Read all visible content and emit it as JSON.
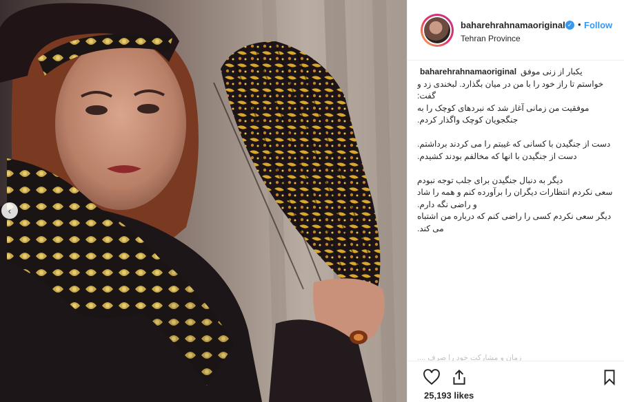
{
  "post": {
    "username": "baharehrahnamaoriginal",
    "follow_label": "Follow",
    "separator": "•",
    "verified_mark": "✓",
    "location": "Tehran Province",
    "caption_lines": [
      "یکبار از زنی موفق",
      "خواستم تا راز خود را با من در میان بگذارد. لبخندی زد و گفت:",
      "موفقیت من زمانی آغاز شد که نبردهای کوچک را به جنگجویان کوچک واگذار کردم.",
      "",
      "دست از جنگیدن با کسانی که غیبتم را می کردند برداشتم.",
      "دست از جنگیدن با انها که مخالفم بودند کشیدم.",
      "",
      "دیگر به دنبال جنگیدن برای جلب توجه نبودم",
      "سعی نکردم انتظارات دیگران را برآورده کنم و همه را شاد و راضی نگه دارم.",
      "دیگر سعی نکردم کسی را راضی کنم که درباره من اشتباه می کند."
    ],
    "faded_line": "زمان و مشارکت خود را صرف ....",
    "likes": "25,193 likes",
    "prev_label": "‹"
  },
  "icons": {
    "like": "heart-icon",
    "share": "share-icon",
    "save": "bookmark-icon",
    "prev": "chevron-left-icon",
    "verified": "verified-badge-icon"
  },
  "colors": {
    "accent": "#3897f0",
    "text": "#262626",
    "border": "#efefef"
  }
}
